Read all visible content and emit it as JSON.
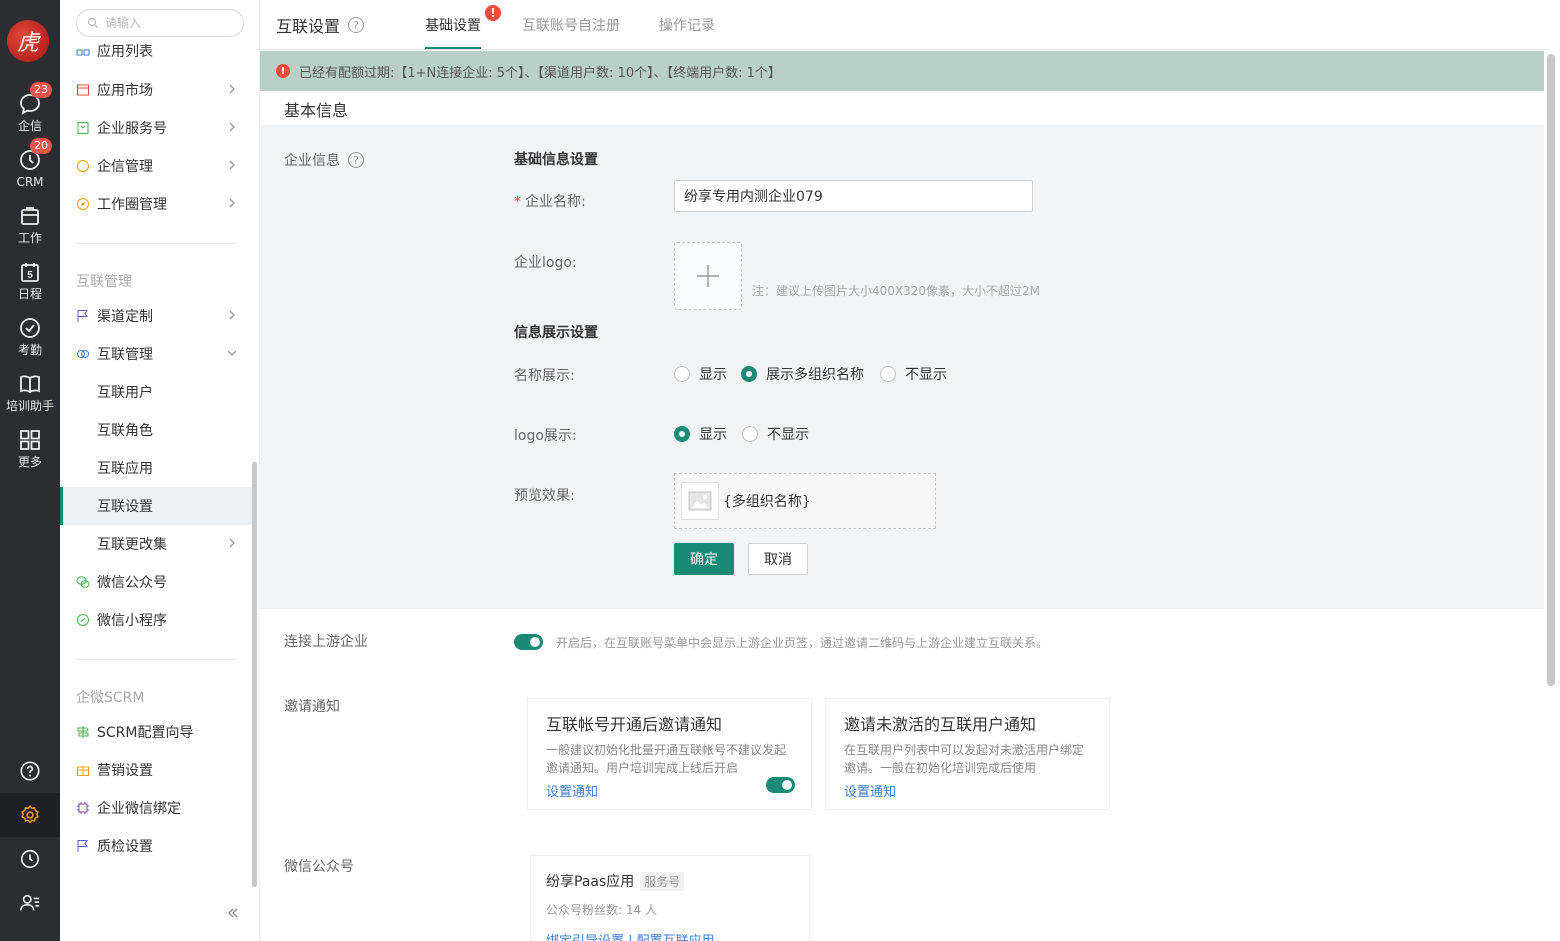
{
  "rail": {
    "logo_text": "虎",
    "items": [
      {
        "label": "企信",
        "badge": "23"
      },
      {
        "label": "CRM",
        "badge": "20"
      },
      {
        "label": "工作"
      },
      {
        "label": "日程",
        "day": "5"
      },
      {
        "label": "考勤"
      },
      {
        "label": "培训助手"
      },
      {
        "label": "更多"
      }
    ]
  },
  "sidebar": {
    "search_placeholder": "请输入",
    "top_items": [
      "应用列表",
      "应用市场",
      "企业服务号",
      "企信管理",
      "工作圈管理"
    ],
    "section_hulian": "互联管理",
    "hulian_items": {
      "channel": "渠道定制",
      "manage": "互联管理",
      "users": "互联用户",
      "roles": "互联角色",
      "apps": "互联应用",
      "settings": "互联设置",
      "changes": "互联更改集",
      "wechat_oa": "微信公众号",
      "wechat_mini": "微信小程序"
    },
    "section_scrm": "企微SCRM",
    "scrm_items": [
      "SCRM配置向导",
      "营销设置",
      "企业微信绑定",
      "质检设置"
    ]
  },
  "header": {
    "title": "互联设置",
    "tabs": [
      "基础设置",
      "互联账号自注册",
      "操作记录"
    ],
    "tab_alert": "!"
  },
  "notice": {
    "icon": "!",
    "text": "已经有配额过期:【1+N连接企业: 5个】、【渠道用户数: 10个】、【终端用户数: 1个】"
  },
  "basic": {
    "section_title": "基本信息",
    "company_info_label": "企业信息",
    "group1": "基础信息设置",
    "company_name_label": "企业名称:",
    "company_name_value": "纷享专用内测企业079",
    "logo_label": "企业logo:",
    "logo_note": "注：建议上传图片大小400X320像素，大小不超过2M",
    "group2": "信息展示设置",
    "name_display_label": "名称展示:",
    "name_options": [
      "显示",
      "展示多组织名称",
      "不显示"
    ],
    "name_selected": 1,
    "logo_display_label": "logo展示:",
    "logo_options": [
      "显示",
      "不显示"
    ],
    "logo_selected": 0,
    "preview_label": "预览效果:",
    "preview_text": "{多组织名称}",
    "confirm": "确定",
    "cancel": "取消"
  },
  "upstream": {
    "label": "连接上游企业",
    "enabled": true,
    "desc": "开启后，在互联账号菜单中会显示上游企业页签，通过邀请二维码与上游企业建立互联关系。"
  },
  "invite": {
    "label": "邀请通知",
    "cards": [
      {
        "title": "互联帐号开通后邀请通知",
        "desc": "一般建议初始化批量开通互联帐号不建议发起邀请通知。用户培训完成上线后开启",
        "link": "设置通知",
        "toggle": true
      },
      {
        "title": "邀请未激活的互联用户通知",
        "desc": "在互联用户列表中可以发起对未激活用户绑定邀请。一般在初始化培训完成后使用",
        "link": "设置通知"
      }
    ]
  },
  "wechat": {
    "label": "微信公众号",
    "name": "纷享Paas应用",
    "tag": "服务号",
    "fans": "公众号粉丝数:  14 人",
    "links": "绑定引导设置 | 配置互联应用"
  }
}
